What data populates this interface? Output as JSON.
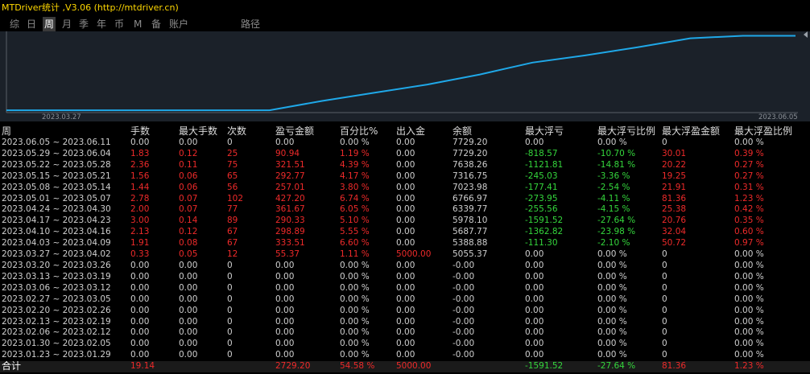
{
  "app": {
    "title": "MTDriver统计 ,V3.06 (http://mtdriver.cn)"
  },
  "tabs": [
    {
      "label": "综",
      "active": false
    },
    {
      "label": "日",
      "active": false
    },
    {
      "label": "周",
      "active": true
    },
    {
      "label": "月",
      "active": false
    },
    {
      "label": "季",
      "active": false
    },
    {
      "label": "年",
      "active": false
    },
    {
      "label": "币",
      "active": false
    },
    {
      "label": "M",
      "active": false
    },
    {
      "label": "备",
      "active": false
    },
    {
      "label": "账户",
      "active": false
    },
    {
      "label": "路径",
      "active": false
    }
  ],
  "chart_data": {
    "type": "line",
    "x_start_label": "2023.03.27",
    "x_end_label": "2023.06.05",
    "line_color": "#1fa8e8",
    "background": "#1b2129",
    "series": [
      {
        "values": [
          5055.37,
          5055.37,
          5055.37,
          5055.37,
          5055.37,
          5055.37,
          5388.88,
          5687.77,
          5978.1,
          6339.77,
          6766.97,
          7023.98,
          7316.75,
          7638.26,
          7729.2,
          7729.2
        ]
      }
    ],
    "ylim": [
      5000,
      7800
    ]
  },
  "table": {
    "headers": [
      "周",
      "手数",
      "最大手数",
      "次数",
      "盈亏金额",
      "百分比%",
      "出入金",
      "余额",
      "最大浮亏",
      "最大浮亏比例",
      "最大浮盈金额",
      "最大浮盈比例"
    ],
    "rows": [
      [
        "2023.06.05 ~ 2023.06.11",
        "0.00",
        "0.00",
        "0",
        "0.00",
        "0.00 %",
        "0.00",
        "7729.20",
        "0.00",
        "0.00 %",
        "0",
        "0.00 %"
      ],
      [
        "2023.05.29 ~ 2023.06.04",
        "1.83",
        "0.12",
        "25",
        "90.94",
        "1.19 %",
        "0.00",
        "7729.20",
        "-818.57",
        "-10.70 %",
        "30.01",
        "0.39 %"
      ],
      [
        "2023.05.22 ~ 2023.05.28",
        "2.36",
        "0.11",
        "75",
        "321.51",
        "4.39 %",
        "0.00",
        "7638.26",
        "-1121.81",
        "-14.81 %",
        "20.22",
        "0.27 %"
      ],
      [
        "2023.05.15 ~ 2023.05.21",
        "1.56",
        "0.06",
        "65",
        "292.77",
        "4.17 %",
        "0.00",
        "7316.75",
        "-245.03",
        "-3.36 %",
        "19.25",
        "0.27 %"
      ],
      [
        "2023.05.08 ~ 2023.05.14",
        "1.44",
        "0.06",
        "56",
        "257.01",
        "3.80 %",
        "0.00",
        "7023.98",
        "-177.41",
        "-2.54 %",
        "21.91",
        "0.31 %"
      ],
      [
        "2023.05.01 ~ 2023.05.07",
        "2.78",
        "0.07",
        "102",
        "427.20",
        "6.74 %",
        "0.00",
        "6766.97",
        "-273.95",
        "-4.11 %",
        "81.36",
        "1.23 %"
      ],
      [
        "2023.04.24 ~ 2023.04.30",
        "2.00",
        "0.07",
        "77",
        "361.67",
        "6.05 %",
        "0.00",
        "6339.77",
        "-255.56",
        "-4.15 %",
        "25.38",
        "0.42 %"
      ],
      [
        "2023.04.17 ~ 2023.04.23",
        "3.00",
        "0.14",
        "89",
        "290.33",
        "5.10 %",
        "0.00",
        "5978.10",
        "-1591.52",
        "-27.64 %",
        "20.76",
        "0.35 %"
      ],
      [
        "2023.04.10 ~ 2023.04.16",
        "2.13",
        "0.12",
        "67",
        "298.89",
        "5.55 %",
        "0.00",
        "5687.77",
        "-1362.82",
        "-23.98 %",
        "32.04",
        "0.60 %"
      ],
      [
        "2023.04.03 ~ 2023.04.09",
        "1.91",
        "0.08",
        "67",
        "333.51",
        "6.60 %",
        "0.00",
        "5388.88",
        "-111.30",
        "-2.10 %",
        "50.72",
        "0.97 %"
      ],
      [
        "2023.03.27 ~ 2023.04.02",
        "0.33",
        "0.05",
        "12",
        "55.37",
        "1.11 %",
        "5000.00",
        "5055.37",
        "0.00",
        "0.00 %",
        "0",
        "0.00 %"
      ],
      [
        "2023.03.20 ~ 2023.03.26",
        "0.00",
        "0.00",
        "0",
        "0.00",
        "0.00 %",
        "0.00",
        "-0.00",
        "0.00",
        "0.00 %",
        "0",
        "0.00 %"
      ],
      [
        "2023.03.13 ~ 2023.03.19",
        "0.00",
        "0.00",
        "0",
        "0.00",
        "0.00 %",
        "0.00",
        "-0.00",
        "0.00",
        "0.00 %",
        "0",
        "0.00 %"
      ],
      [
        "2023.03.06 ~ 2023.03.12",
        "0.00",
        "0.00",
        "0",
        "0.00",
        "0.00 %",
        "0.00",
        "-0.00",
        "0.00",
        "0.00 %",
        "0",
        "0.00 %"
      ],
      [
        "2023.02.27 ~ 2023.03.05",
        "0.00",
        "0.00",
        "0",
        "0.00",
        "0.00 %",
        "0.00",
        "-0.00",
        "0.00",
        "0.00 %",
        "0",
        "0.00 %"
      ],
      [
        "2023.02.20 ~ 2023.02.26",
        "0.00",
        "0.00",
        "0",
        "0.00",
        "0.00 %",
        "0.00",
        "-0.00",
        "0.00",
        "0.00 %",
        "0",
        "0.00 %"
      ],
      [
        "2023.02.13 ~ 2023.02.19",
        "0.00",
        "0.00",
        "0",
        "0.00",
        "0.00 %",
        "0.00",
        "-0.00",
        "0.00",
        "0.00 %",
        "0",
        "0.00 %"
      ],
      [
        "2023.02.06 ~ 2023.02.12",
        "0.00",
        "0.00",
        "0",
        "0.00",
        "0.00 %",
        "0.00",
        "-0.00",
        "0.00",
        "0.00 %",
        "0",
        "0.00 %"
      ],
      [
        "2023.01.30 ~ 2023.02.05",
        "0.00",
        "0.00",
        "0",
        "0.00",
        "0.00 %",
        "0.00",
        "-0.00",
        "0.00",
        "0.00 %",
        "0",
        "0.00 %"
      ],
      [
        "2023.01.23 ~ 2023.01.29",
        "0.00",
        "0.00",
        "0",
        "0.00",
        "0.00 %",
        "0.00",
        "-0.00",
        "0.00",
        "0.00 %",
        "0",
        "0.00 %"
      ]
    ],
    "total": [
      "合计",
      "19.14",
      "",
      "",
      "2729.20",
      "54.58 %",
      "5000.00",
      "",
      "-1591.52",
      "-27.64 %",
      "81.36",
      "1.23 %"
    ]
  },
  "colors": {
    "positive": "#ee2a2a",
    "negative": "#34d63c",
    "neutral": "#cfcfcf",
    "title": "#ffd800"
  }
}
